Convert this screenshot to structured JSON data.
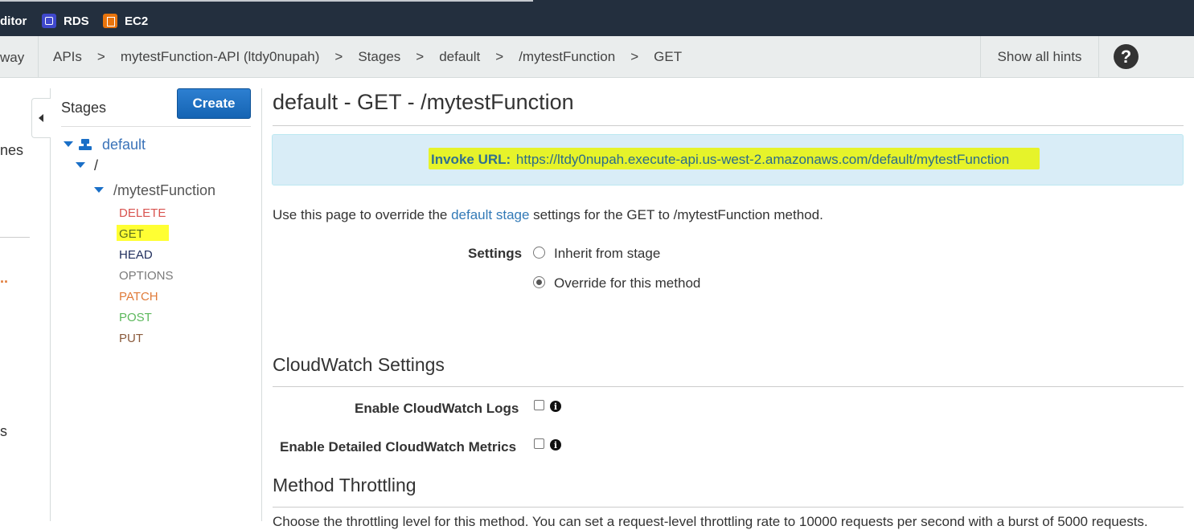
{
  "topnav": {
    "items": [
      {
        "label": "ditor",
        "icon": "none"
      },
      {
        "label": "RDS",
        "icon": "rds-icon"
      },
      {
        "label": "EC2",
        "icon": "ec2-icon"
      }
    ]
  },
  "breadcrumb": {
    "service_fragment": "way",
    "items": [
      "APIs",
      "mytestFunction-API (ltdy0nupah)",
      "Stages",
      "default",
      "/mytestFunction",
      "GET"
    ],
    "separator": ">",
    "show_hints": "Show all hints",
    "help": "?"
  },
  "leftnav": {
    "fragments": [
      "nes",
      "..",
      "s"
    ]
  },
  "stages_panel": {
    "title": "Stages",
    "create_label": "Create",
    "stage": "default",
    "root_resource": "/",
    "resource": "/mytestFunction",
    "methods": [
      {
        "label": "DELETE",
        "color": "#d9534f"
      },
      {
        "label": "GET",
        "color": "#5a6e1f"
      },
      {
        "label": "HEAD",
        "color": "#1f2d5c"
      },
      {
        "label": "OPTIONS",
        "color": "#7a7a7a"
      },
      {
        "label": "PATCH",
        "color": "#e07b39"
      },
      {
        "label": "POST",
        "color": "#5cb85c"
      },
      {
        "label": "PUT",
        "color": "#8a5a3c"
      }
    ]
  },
  "main": {
    "title": "default - GET - /mytestFunction",
    "invoke_label": "Invoke URL:",
    "invoke_url": "https://ltdy0nupah.execute-api.us-west-2.amazonaws.com/default/mytestFunction",
    "desc_before": "Use this page to override the ",
    "desc_link": "default stage",
    "desc_after": " settings for the GET to /mytestFunction method.",
    "settings_label": "Settings",
    "radio_options": [
      "Inherit from stage",
      "Override for this method"
    ],
    "selected_option": "Override for this method",
    "cloudwatch_title": "CloudWatch Settings",
    "cloudwatch_logs": "Enable CloudWatch Logs",
    "cloudwatch_metrics": "Enable Detailed CloudWatch Metrics",
    "throttling_title": "Method Throttling",
    "throttling_desc": "Choose the throttling level for this method. You can set a request-level throttling rate to 10000 requests per second with a burst of 5000 requests."
  }
}
